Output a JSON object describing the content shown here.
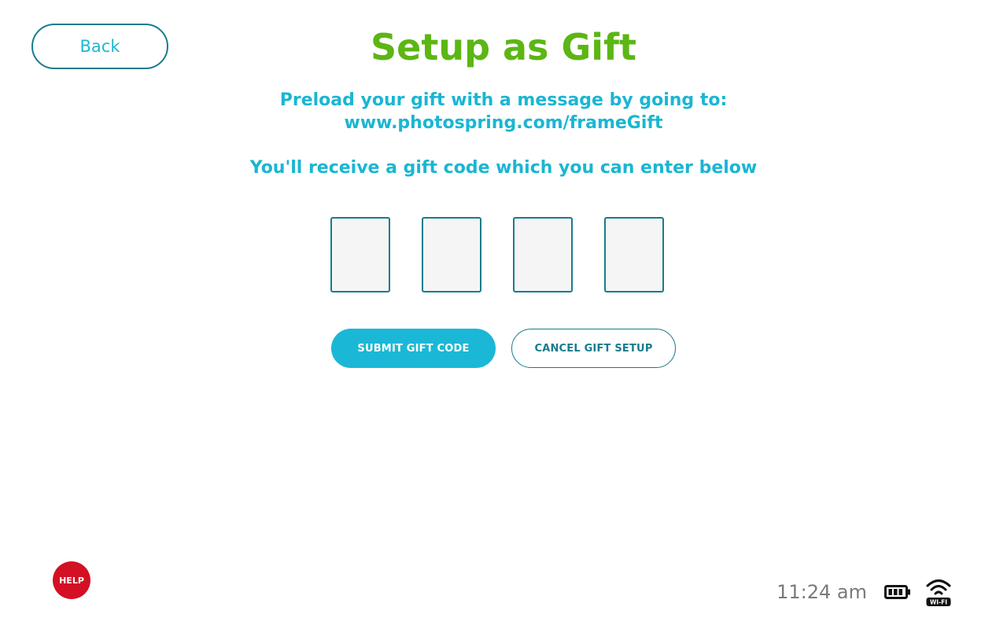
{
  "header": {
    "back_label": "Back",
    "title": "Setup as Gift"
  },
  "instructions": {
    "line1": "Preload your gift with a message by going to:",
    "line2": "www.photospring.com/frameGift",
    "line3": "You'll receive a gift code which you can enter below"
  },
  "gift_code": {
    "boxes": [
      "",
      "",
      "",
      ""
    ]
  },
  "actions": {
    "submit_label": "SUBMIT GIFT CODE",
    "cancel_label": "CANCEL GIFT SETUP"
  },
  "footer": {
    "help_label": "HELP",
    "time": "11:24 am",
    "battery_icon": "battery-icon",
    "wifi_icon": "wifi-icon",
    "wifi_label": "WI-FI"
  },
  "colors": {
    "title_green": "#5cb613",
    "accent_cyan": "#1ab8d6",
    "border_teal": "#177c8c",
    "help_red": "#d41024"
  }
}
